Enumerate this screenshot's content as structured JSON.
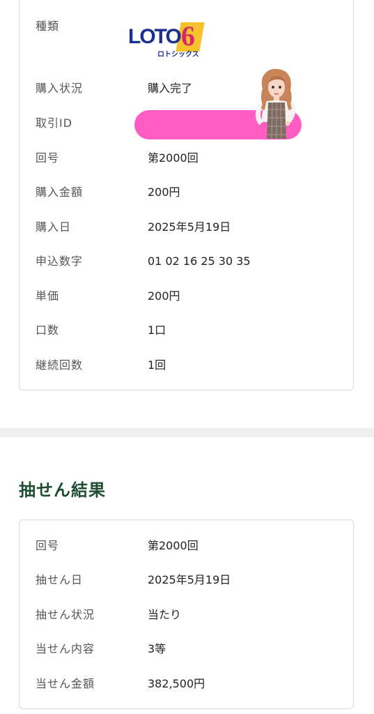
{
  "purchase": {
    "logo": {
      "word": "LOTO",
      "number": "6",
      "kana": "ロトシックス"
    },
    "rows": [
      {
        "label": "種類",
        "value": ""
      },
      {
        "label": "購入状況",
        "value": "購入完了"
      },
      {
        "label": "取引ID",
        "value": ""
      },
      {
        "label": "回号",
        "value": "第2000回"
      },
      {
        "label": "購入金額",
        "value": "200円"
      },
      {
        "label": "購入日",
        "value": "2025年5月19日"
      },
      {
        "label": "申込数字",
        "value": "01 02 16 25 30 35"
      },
      {
        "label": "単価",
        "value": "200円"
      },
      {
        "label": "口数",
        "value": "1口"
      },
      {
        "label": "継続回数",
        "value": "1回"
      }
    ]
  },
  "result": {
    "title": "抽せん結果",
    "rows": [
      {
        "label": "回号",
        "value": "第2000回"
      },
      {
        "label": "抽せん日",
        "value": "2025年5月19日"
      },
      {
        "label": "抽せん状況",
        "value": "当たり"
      },
      {
        "label": "当せん内容",
        "value": "3等"
      },
      {
        "label": "当せん金額",
        "value": "382,500円"
      }
    ]
  },
  "colors": {
    "title_green": "#1f4d33",
    "redaction_pink": "#ff5dc3",
    "card_border": "#d9d9d9",
    "divider": "#eef0ef"
  }
}
